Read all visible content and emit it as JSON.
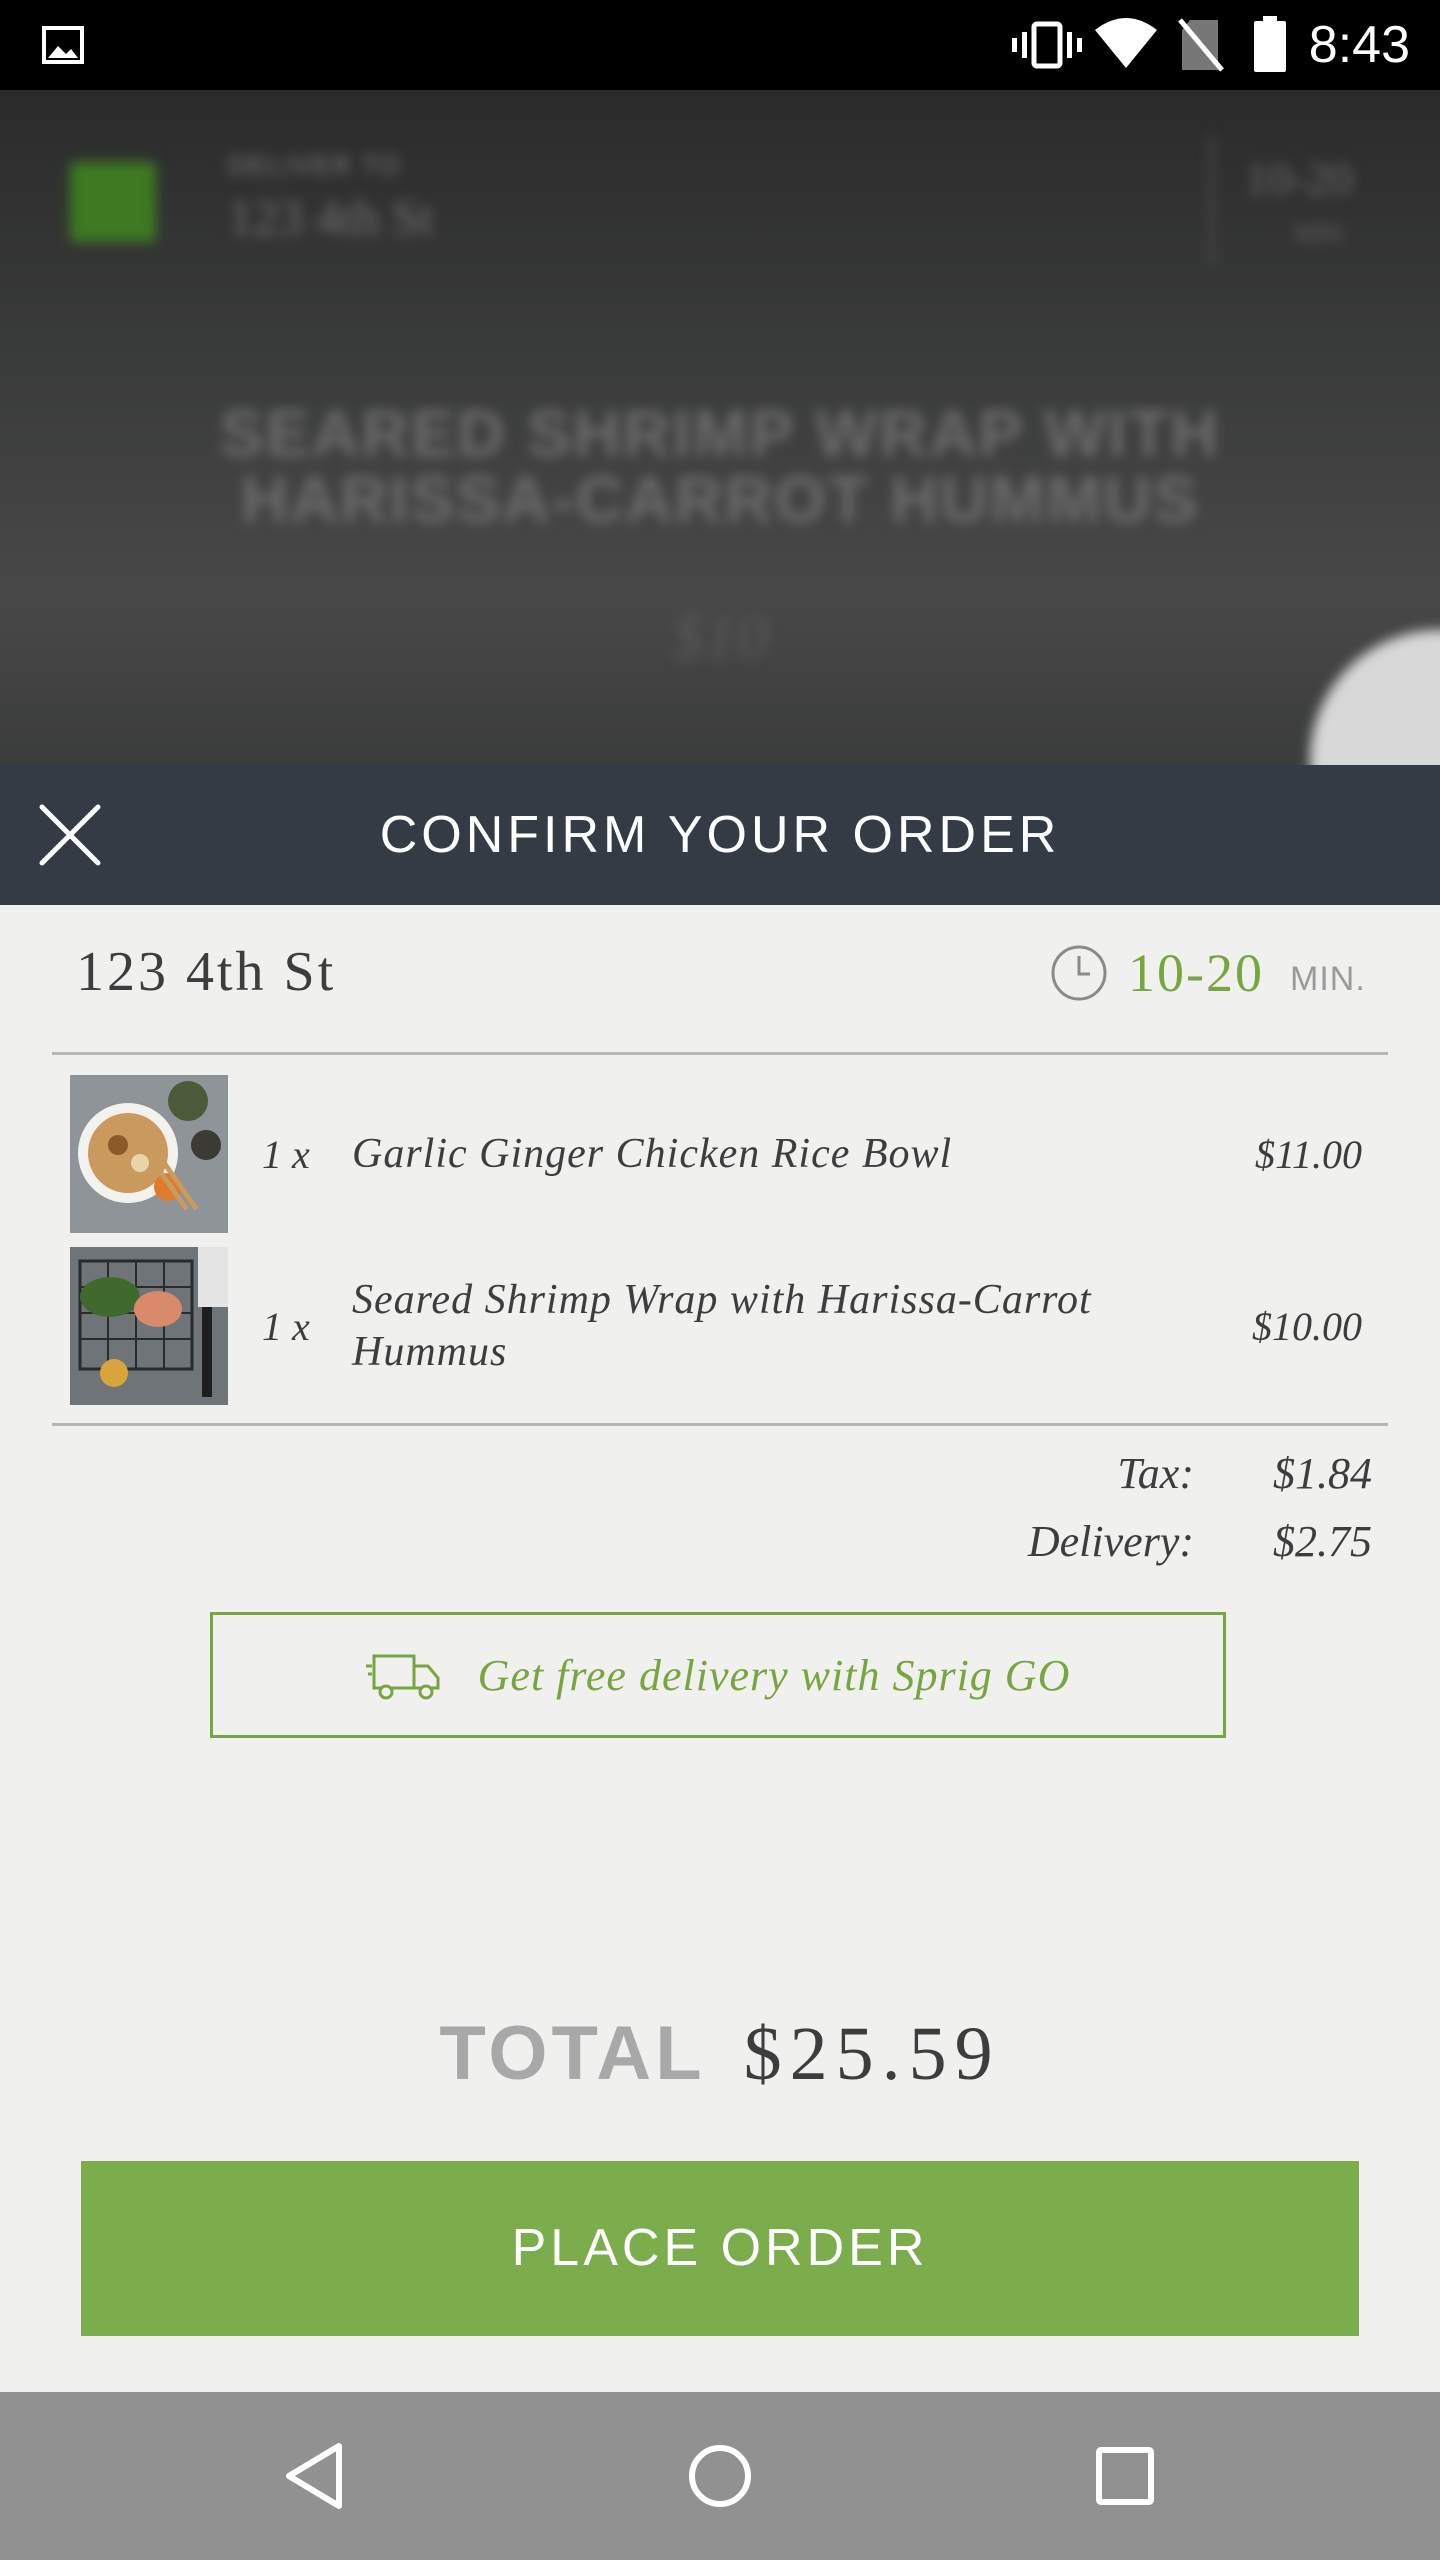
{
  "status_bar": {
    "time": "8:43",
    "icons": [
      "image-icon",
      "vibrate-icon",
      "wifi-icon",
      "no-sim-icon",
      "battery-icon"
    ]
  },
  "background": {
    "deliver_to_label": "DELIVER TO",
    "address": "123 4th St",
    "eta": "10-20",
    "eta_unit": "MIN",
    "title": "SEARED SHRIMP WRAP WITH HARISSA-CARROT HUMMUS",
    "price": "$10"
  },
  "header": {
    "title": "CONFIRM YOUR ORDER",
    "close_icon": "close-icon"
  },
  "delivery": {
    "address": "123 4th St",
    "eta_range": "10-20",
    "eta_unit": "MIN.",
    "clock_icon": "clock-icon"
  },
  "order": {
    "items": [
      {
        "qty": "1 x",
        "name": "Garlic Ginger Chicken Rice Bowl",
        "price": "$11.00"
      },
      {
        "qty": "1 x",
        "name": "Seared Shrimp Wrap with Harissa-Carrot Hummus",
        "price": "$10.00"
      }
    ]
  },
  "fees": {
    "tax_label": "Tax:",
    "tax_value": "$1.84",
    "delivery_label": "Delivery:",
    "delivery_value": "$2.75"
  },
  "promo": {
    "text": "Get free delivery with Sprig GO",
    "icon": "truck-icon"
  },
  "total": {
    "label": "TOTAL",
    "value": "$25.59"
  },
  "actions": {
    "place_order": "PLACE ORDER"
  },
  "nav_bar": {
    "icons": [
      "back-icon",
      "home-icon",
      "recents-icon"
    ]
  },
  "colors": {
    "accent": "#7bad4c",
    "accent_text": "#78a540",
    "header_bg": "#353b45",
    "page_bg": "#f0f0ef",
    "text": "#3d3d3d"
  }
}
